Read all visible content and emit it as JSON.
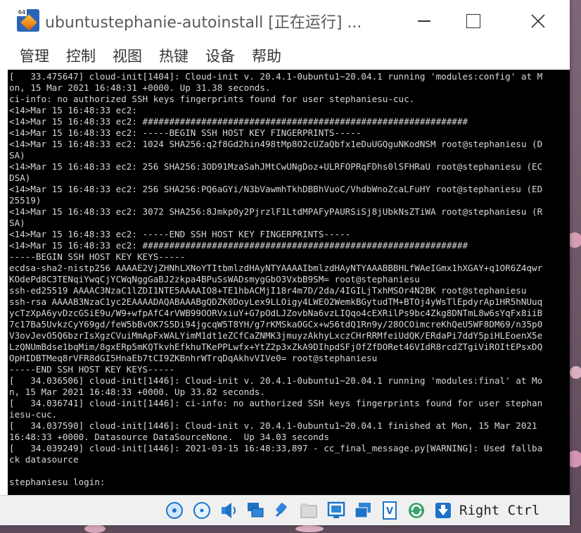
{
  "window": {
    "title": "ubuntustephanie-autoinstall [正在运行] ...",
    "app_badge": "64"
  },
  "menu": [
    "管理",
    "控制",
    "视图",
    "热键",
    "设备",
    "帮助"
  ],
  "console": {
    "lines": [
      "[   33.475647] cloud-init[1404]: Cloud-init v. 20.4.1-0ubuntu1~20.04.1 running 'modules:config' at M",
      "on, 15 Mar 2021 16:48:31 +0000. Up 31.38 seconds.",
      "ci-info: no authorized SSH keys fingerprints found for user stephaniesu-cuc.",
      "<14>Mar 15 16:48:33 ec2:",
      "<14>Mar 15 16:48:33 ec2: #############################################################",
      "<14>Mar 15 16:48:33 ec2: -----BEGIN SSH HOST KEY FINGERPRINTS-----",
      "<14>Mar 15 16:48:33 ec2: 1024 SHA256:q2f8Gd2hin498tMp8O2cUZaQbfx1eDuUGQguNKodNSM root@stephaniesu (D",
      "SA)",
      "<14>Mar 15 16:48:33 ec2: 256 SHA256:3OD91MzaSahJMtCwUNgDoz+ULRFOPRqFDhs0lSFHRaU root@stephaniesu (EC",
      "DSA)",
      "<14>Mar 15 16:48:33 ec2: 256 SHA256:PQ6aGYi/N3bVawmhTkhDBBhVuoC/VhdbWnoZcaLFuHY root@stephaniesu (ED",
      "25519)",
      "<14>Mar 15 16:48:33 ec2: 3072 SHA256:8Jmkp0y2PjrzlF1LtdMPAFyPAURSiSj8jUbkNsZTiWA root@stephaniesu (R",
      "SA)",
      "<14>Mar 15 16:48:33 ec2: -----END SSH HOST KEY FINGERPRINTS-----",
      "<14>Mar 15 16:48:33 ec2: #############################################################",
      "-----BEGIN SSH HOST KEY KEYS-----",
      "ecdsa-sha2-nistp256 AAAAE2VjZHNhLXNoYTItbmlzdHAyNTYAAAAIbmlzdHAyNTYAAABBBHLfWAeIGmx1hXGAY+q1OR6Z4qwr",
      "KOdePd8C3TENqiYwqCjYCWqNggGaBJ2zkpa4BPuSsWADsmygGbO3VxbB9SM= root@stephaniesu",
      "ssh-ed25519 AAAAC3NzaC1lZDI1NTE5AAAAIO8+TE1hbACMjI18r4m7D/2da/4IGILjTxhMSOr4N2BK root@stephaniesu",
      "ssh-rsa AAAAB3NzaC1yc2EAAAADAQABAAABgQDZK0DoyLex9LLOigy4LWEO2WemkBGytudTM+BTOj4yWsTlEpdyrAp1HR5hNUuq",
      "ycTzXpA6yvDzcGSiE9u/W9+wfpAfC4rVWB99OORVxiuY+G7pOdLJZovbNa6vzLIQqo4cEXRilPs9bc4Zkg8DNTmL8w6sYqFx8iiB",
      "7c17Ba5UvkzCyY69gd/feW5bBvOK7S5Di94jgcqW5T8YH/g7rKMSkaOGCx+w56tdQ1Rn9y/28OCOimcreKhQeU5WF8DM69/n35p0",
      "V3ovJevO5Q6bzrIsXgzCVuiMmApFxWALYimM1dt1eZCfCaZNMK3jmuyzAkhyLxczCHrRRMfeiUdQK/ERdaPi7ddY5piHLEoenX5e",
      "LzQNUmBdse1bqMim/8gxERp5mKQTkvhEfkhuTKePPLwfx+YtZ2p3xZkA9DIhpdSFjOfZfDORet46VIdR8rcdZTgiViROItEPsxDQ",
      "OpHIDBTMeq8rVFR8dGI5HnaEb7tCI9ZKBnhrWTrqDqAkhvVIVe0= root@stephaniesu",
      "-----END SSH HOST KEY KEYS-----",
      "[   34.036506] cloud-init[1446]: Cloud-init v. 20.4.1-0ubuntu1~20.04.1 running 'modules:final' at Mo",
      "n, 15 Mar 2021 16:48:33 +0000. Up 33.82 seconds.",
      "[   34.036741] cloud-init[1446]: ci-info: no authorized SSH keys fingerprints found for user stephan",
      "iesu-cuc.",
      "[   34.037590] cloud-init[1446]: Cloud-init v. 20.4.1-0ubuntu1~20.04.1 finished at Mon, 15 Mar 2021",
      "16:48:33 +0000. Datasource DataSourceNone.  Up 34.03 seconds",
      "[   34.039249] cloud-init[1446]: 2021-03-15 16:48:33,897 - cc_final_message.py[WARNING]: Used fallba",
      "ck datasource",
      "",
      "stephaniesu login:"
    ]
  },
  "statusbar": {
    "host_key_label": "Right Ctrl",
    "icons": [
      "hard-disk-icon",
      "optical-drive-icon",
      "audio-icon",
      "network-icon",
      "usb-icon",
      "shared-folder-icon",
      "display-icon",
      "screen-capture-icon",
      "virtualization-icon",
      "mouse-integration-icon",
      "keyboard-capture-icon"
    ]
  },
  "colors": {
    "console_bg": "#000000",
    "console_fg": "#d8d8d8",
    "accent_blue": "#1e73c8"
  }
}
